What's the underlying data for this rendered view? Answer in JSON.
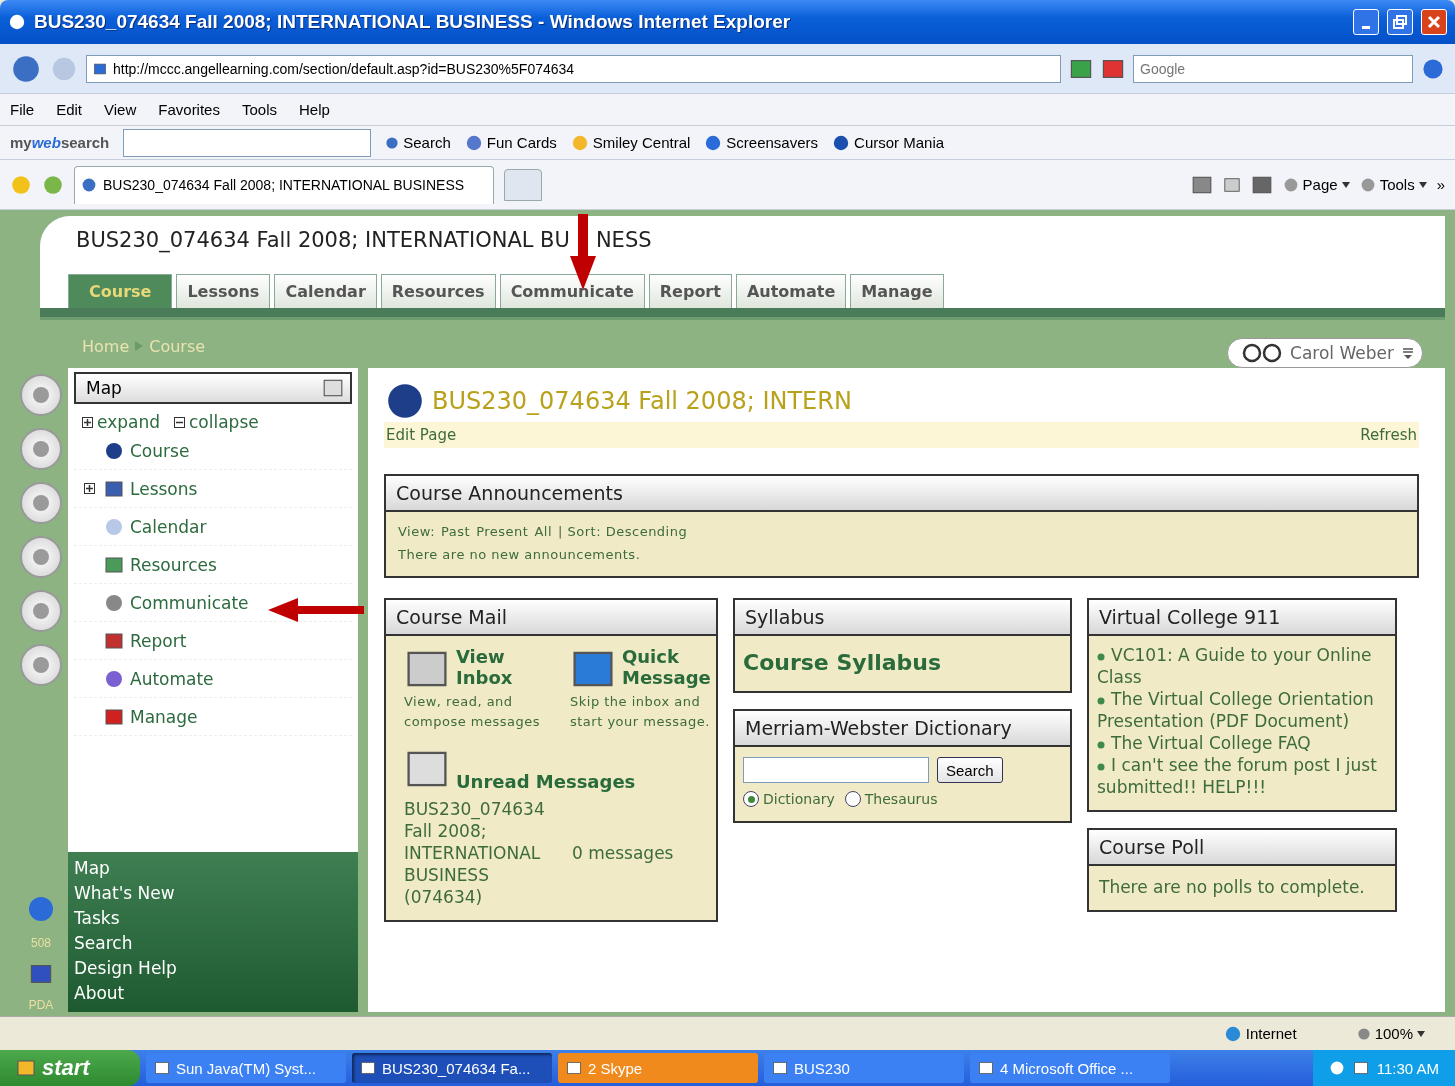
{
  "window": {
    "title": "BUS230_074634 Fall 2008; INTERNATIONAL BUSINESS - Windows Internet Explorer"
  },
  "address_bar": {
    "url": "http://mccc.angellearning.com/section/default.asp?id=BUS230%5F074634",
    "search_placeholder": "Google"
  },
  "menu": [
    "File",
    "Edit",
    "View",
    "Favorites",
    "Tools",
    "Help"
  ],
  "search_toolbar": {
    "brand": "my**web**search",
    "search_button": "Search",
    "links": [
      "Fun Cards",
      "Smiley Central",
      "Screensavers",
      "Cursor Mania"
    ]
  },
  "tab_bar": {
    "tab": "BUS230_074634 Fall 2008; INTERNATIONAL BUSINESS",
    "commands": [
      "Page",
      "Tools"
    ],
    "overflow": "»"
  },
  "course": {
    "title_parts": [
      "BUS230_074634 Fall 2008; INTERNATIONAL BU",
      "NESS"
    ],
    "tabs": [
      {
        "label": "Course",
        "selected": true
      },
      {
        "label": "Lessons",
        "selected": false
      },
      {
        "label": "Calendar",
        "selected": false
      },
      {
        "label": "Resources",
        "selected": false
      },
      {
        "label": "Communicate",
        "selected": false
      },
      {
        "label": "Report",
        "selected": false
      },
      {
        "label": "Automate",
        "selected": false
      },
      {
        "label": "Manage",
        "selected": false
      }
    ]
  },
  "breadcrumb": [
    "Home",
    "Course"
  ],
  "user": {
    "name": "Carol Weber"
  },
  "rail": {
    "accessibility": "508",
    "pda": "PDA"
  },
  "map": {
    "title": "Map",
    "expand": "expand",
    "collapse": "collapse",
    "items": [
      {
        "label": "Course",
        "expandable": false
      },
      {
        "label": "Lessons",
        "expandable": true
      },
      {
        "label": "Calendar",
        "expandable": false
      },
      {
        "label": "Resources",
        "expandable": false
      },
      {
        "label": "Communicate",
        "expandable": false
      },
      {
        "label": "Report",
        "expandable": false
      },
      {
        "label": "Automate",
        "expandable": false
      },
      {
        "label": "Manage",
        "expandable": false
      }
    ],
    "links": [
      "Map",
      "What's New",
      "Tasks",
      "Search",
      "Design Help",
      "About"
    ]
  },
  "page": {
    "heading": "BUS230_074634 Fall 2008; INTERN",
    "edit": "Edit Page",
    "refresh": "Refresh"
  },
  "announcements": {
    "title": "Course Announcements",
    "view_label": "View:",
    "views": [
      "Past",
      "Present",
      "All"
    ],
    "sort": "| Sort: Descending",
    "message": "There are no new announcements."
  },
  "course_mail": {
    "title": "Course Mail",
    "actions": [
      {
        "title": "View Inbox",
        "description": "View, read, and compose messages"
      },
      {
        "title": "Quick Message",
        "description": "Skip the inbox and start your message."
      }
    ],
    "unread": {
      "title": "Unread Messages",
      "course": "BUS230_074634 Fall 2008; INTERNATIONAL BUSINESS (074634)",
      "count": "0 messages"
    }
  },
  "syllabus": {
    "title": "Syllabus",
    "link": "Course Syllabus"
  },
  "dictionary": {
    "title": "Merriam-Webster Dictionary",
    "button": "Search",
    "options": [
      {
        "label": "Dictionary",
        "selected": true
      },
      {
        "label": "Thesaurus",
        "selected": false
      }
    ]
  },
  "vc911": {
    "title": "Virtual College 911",
    "links": [
      "VC101: A Guide to your Online Class",
      "The Virtual College Orientation Presentation (PDF Document)",
      "The Virtual College FAQ",
      "I can't see the forum post I just submitted!! HELP!!!"
    ]
  },
  "poll": {
    "title": "Course Poll",
    "message": "There are no polls to complete."
  },
  "status_bar": {
    "zone": "Internet",
    "zoom": "100%"
  },
  "taskbar": {
    "start": "start",
    "items": [
      {
        "label": "Sun Java(TM) Syst...",
        "selected": false,
        "flashing": false
      },
      {
        "label": "BUS230_074634 Fa...",
        "selected": true,
        "flashing": false
      },
      {
        "label": "2 Skype",
        "selected": false,
        "flashing": true
      },
      {
        "label": "BUS230",
        "selected": false,
        "flashing": false
      },
      {
        "label": "4 Microsoft Office ...",
        "selected": false,
        "flashing": false
      }
    ],
    "clock": "11:30 AM"
  }
}
